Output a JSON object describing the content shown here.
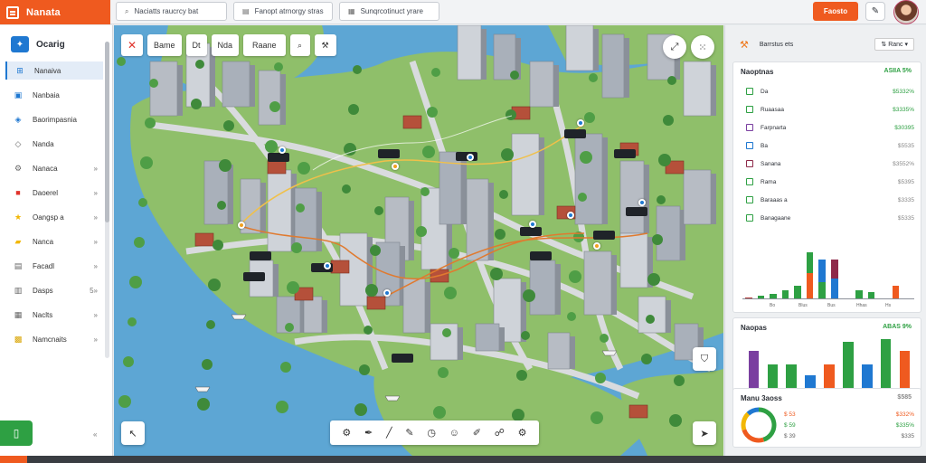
{
  "app": {
    "name": "Nanata"
  },
  "tabs": [
    {
      "label": "Naciatts raucrcy bat"
    },
    {
      "label": "Fanopt atrnorgy stras"
    },
    {
      "label": "Sunqrcotinuct yrare"
    }
  ],
  "topbar": {
    "action_label": "Faosto"
  },
  "sidebar": {
    "header": "Ocarig",
    "items": [
      {
        "label": "Nanaiva",
        "icon": "map-icon",
        "active": true,
        "chevron": ""
      },
      {
        "label": "Nanbaia",
        "icon": "image-icon",
        "active": false,
        "chevron": ""
      },
      {
        "label": "Baorimpasnia",
        "icon": "layers-icon",
        "active": false,
        "chevron": ""
      },
      {
        "label": "Nanda",
        "icon": "tag-icon",
        "active": false,
        "chevron": ""
      },
      {
        "label": "Nanaca",
        "icon": "gear-icon",
        "active": false,
        "chevron": "»"
      },
      {
        "label": "Daoerel",
        "icon": "bookmark-icon",
        "active": false,
        "chevron": "»"
      },
      {
        "label": "Oangsp a",
        "icon": "star-icon",
        "active": false,
        "chevron": "»"
      },
      {
        "label": "Nanca",
        "icon": "folder-icon",
        "active": false,
        "chevron": "»"
      },
      {
        "label": "Facadl",
        "icon": "note-icon",
        "active": false,
        "chevron": "»"
      },
      {
        "label": "Dasps",
        "icon": "file-icon",
        "active": false,
        "chevron": "5»"
      },
      {
        "label": "Naclts",
        "icon": "package-icon",
        "active": false,
        "chevron": "»"
      },
      {
        "label": "Namcnaits",
        "icon": "chat-icon",
        "active": false,
        "chevron": "»"
      }
    ],
    "bottom_chevron": "«"
  },
  "map_toolbar": {
    "b1": "Bame",
    "b2": "Dt",
    "b3": "Nda",
    "b4": "Raane"
  },
  "map_labels": [
    {
      "text": ""
    },
    {
      "text": ""
    },
    {
      "text": ""
    },
    {
      "text": ""
    },
    {
      "text": ""
    },
    {
      "text": ""
    },
    {
      "text": ""
    },
    {
      "text": ""
    },
    {
      "text": ""
    },
    {
      "text": ""
    },
    {
      "text": ""
    },
    {
      "text": ""
    },
    {
      "text": ""
    }
  ],
  "right_panel": {
    "header_label": "Barrstus ets",
    "dropdown": "Ranc",
    "card1": {
      "title": "Naoptnas",
      "total": "ASIIA 5%",
      "rows": [
        {
          "label": "Da",
          "value": "$5332%",
          "color": "#2ea043",
          "tone": "green"
        },
        {
          "label": "Ruaasaa",
          "value": "$3335%",
          "color": "#2ea043",
          "tone": "green"
        },
        {
          "label": "Farpnarta",
          "value": "$30395",
          "color": "#7a3fa0",
          "tone": "green"
        },
        {
          "label": "Ba",
          "value": "$5535",
          "color": "#1f78d1",
          "tone": "gray"
        },
        {
          "label": "Sanana",
          "value": "$3552%",
          "color": "#8e2a4a",
          "tone": "gray"
        },
        {
          "label": "Rama",
          "value": "$5395",
          "color": "#2ea043",
          "tone": "gray"
        },
        {
          "label": "Baraaas a",
          "value": "$3335",
          "color": "#2ea043",
          "tone": "gray"
        },
        {
          "label": "Banagaane",
          "value": "$5335",
          "color": "#2ea043",
          "tone": "gray"
        }
      ],
      "x_ticks": [
        "Bo",
        "Blus",
        "Bus",
        "Hhas",
        "Hs"
      ]
    },
    "card2": {
      "title": "Naopas",
      "total": "ABAS 9%"
    },
    "card3": {
      "title": "Manu 3aoss",
      "total": "$585",
      "rows": [
        {
          "label": "$ 53",
          "value": "$332%"
        },
        {
          "label": "$ 59",
          "value": "$335%"
        },
        {
          "label": "$ 39",
          "value": "$335"
        }
      ]
    }
  },
  "chart_data": [
    {
      "type": "bar",
      "title": "Naoptnas",
      "categories": [
        "",
        "",
        "",
        "",
        "",
        "",
        "",
        "",
        "",
        "",
        "",
        "",
        "",
        ""
      ],
      "series": [
        {
          "values": [
            1,
            2,
            3,
            5,
            7,
            14,
            9,
            11,
            0,
            5,
            4,
            0,
            7,
            0
          ]
        }
      ],
      "stacked_extra": [
        0,
        0,
        0,
        0,
        0,
        11,
        12,
        10,
        0,
        0,
        0,
        0,
        0,
        0
      ],
      "colors": [
        "#b33a3a",
        "#2ea043",
        "#2ea043",
        "#2ea043",
        "#2ea043",
        "#ef5a1f",
        "#2ea043",
        "#1f78d1",
        "#ffffff",
        "#2ea043",
        "#2ea043",
        "#ffffff",
        "#ef5a1f",
        "#ffffff"
      ],
      "stack_colors": [
        "",
        "",
        "",
        "",
        "",
        "#2ea043",
        "#1f78d1",
        "#8e2a4a",
        "",
        "",
        "",
        "",
        "",
        ""
      ],
      "ylim": [
        0,
        25
      ]
    },
    {
      "type": "bar",
      "title": "Naopas",
      "categories": [
        "",
        "",
        "",
        "",
        "",
        "",
        "",
        "",
        ""
      ],
      "series": [
        {
          "values": [
            15,
            10,
            10,
            6,
            10,
            18,
            10,
            19,
            15
          ]
        }
      ],
      "colors": [
        "#7a3fa0",
        "#2ea043",
        "#2ea043",
        "#1f78d1",
        "#ef5a1f",
        "#2ea043",
        "#1f78d1",
        "#2ea043",
        "#ef5a1f"
      ],
      "ylim": [
        0,
        20
      ]
    },
    {
      "type": "pie",
      "title": "Manu 3aoss",
      "values": [
        45,
        25,
        18,
        12
      ],
      "colors": [
        "#2ea043",
        "#ef5a1f",
        "#f2b705",
        "#1f78d1"
      ]
    }
  ]
}
